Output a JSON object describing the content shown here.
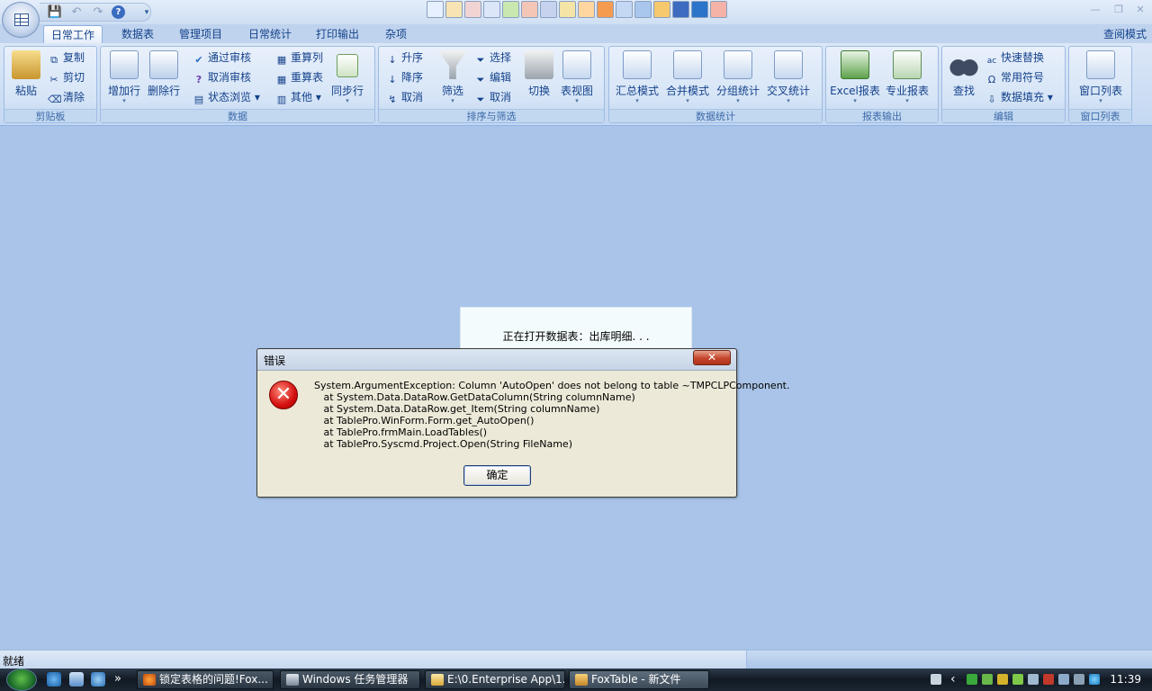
{
  "qat": {
    "save_icon": "save-icon",
    "undo_icon": "undo-icon",
    "redo_icon": "redo-icon",
    "help_icon": "help-icon",
    "more": "▾"
  },
  "tabs": [
    {
      "label": "日常工作",
      "active": true
    },
    {
      "label": "数据表"
    },
    {
      "label": "管理项目"
    },
    {
      "label": "日常统计"
    },
    {
      "label": "打印输出"
    },
    {
      "label": "杂项"
    }
  ],
  "view_mode": "查阅模式",
  "ribbon": {
    "clipboard": {
      "label": "剪贴板",
      "paste": "粘贴",
      "copy": "复制",
      "cut": "剪切",
      "clear": "清除"
    },
    "data": {
      "label": "数据",
      "add_row": "增加行",
      "delete_row": "删除行",
      "approve": "通过审核",
      "unapprove": "取消审核",
      "status_browse": "状态浏览",
      "recalc_col": "重算列",
      "recalc_table": "重算表",
      "other": "其他",
      "sync_row": "同步行"
    },
    "sort_filter": {
      "label": "排序与筛选",
      "asc": "升序",
      "desc": "降序",
      "cancel_sort": "取消",
      "filter": "筛选",
      "select": "选择",
      "edit": "编辑",
      "cancel_filter": "取消",
      "switch": "切换",
      "table_view": "表视图"
    },
    "stats": {
      "label": "数据统计",
      "summary": "汇总模式",
      "merge": "合并模式",
      "group": "分组统计",
      "cross": "交叉统计"
    },
    "report": {
      "label": "报表输出",
      "excel": "Excel报表",
      "pro": "专业报表"
    },
    "edit": {
      "label": "编辑",
      "find": "查找",
      "replace": "快速替换",
      "symbols": "常用符号",
      "fill": "数据填充"
    },
    "windows": {
      "label": "窗口列表",
      "window_list": "窗口列表"
    }
  },
  "loading": {
    "text": "正在打开数据表：出库明细. . ."
  },
  "dialog": {
    "title": "错误",
    "close": "✕",
    "lines": [
      "System.ArgumentException: Column 'AutoOpen' does not belong to table ~TMPCLPComponent.",
      "   at System.Data.DataRow.GetDataColumn(String columnName)",
      "   at System.Data.DataRow.get_Item(String columnName)",
      "   at TablePro.WinForm.Form.get_AutoOpen()",
      "   at TablePro.frmMain.LoadTables()",
      "   at TablePro.Syscmd.Project.Open(String FileName)"
    ],
    "ok": "确定"
  },
  "status": {
    "text": "就绪"
  },
  "taskbar": {
    "more": "»",
    "tasks": [
      {
        "label": "锁定表格的问题!Fox..."
      },
      {
        "label": "Windows 任务管理器"
      },
      {
        "label": "E:\\0.Enterprise App\\1..."
      },
      {
        "label": "FoxTable - 新文件",
        "active": true
      }
    ],
    "tray_arrow": "‹",
    "clock": "11:39"
  },
  "colors": {
    "workspace": "#a9c4e8",
    "ribbon_text": "#15428b",
    "error_red": "#d40f0f"
  }
}
